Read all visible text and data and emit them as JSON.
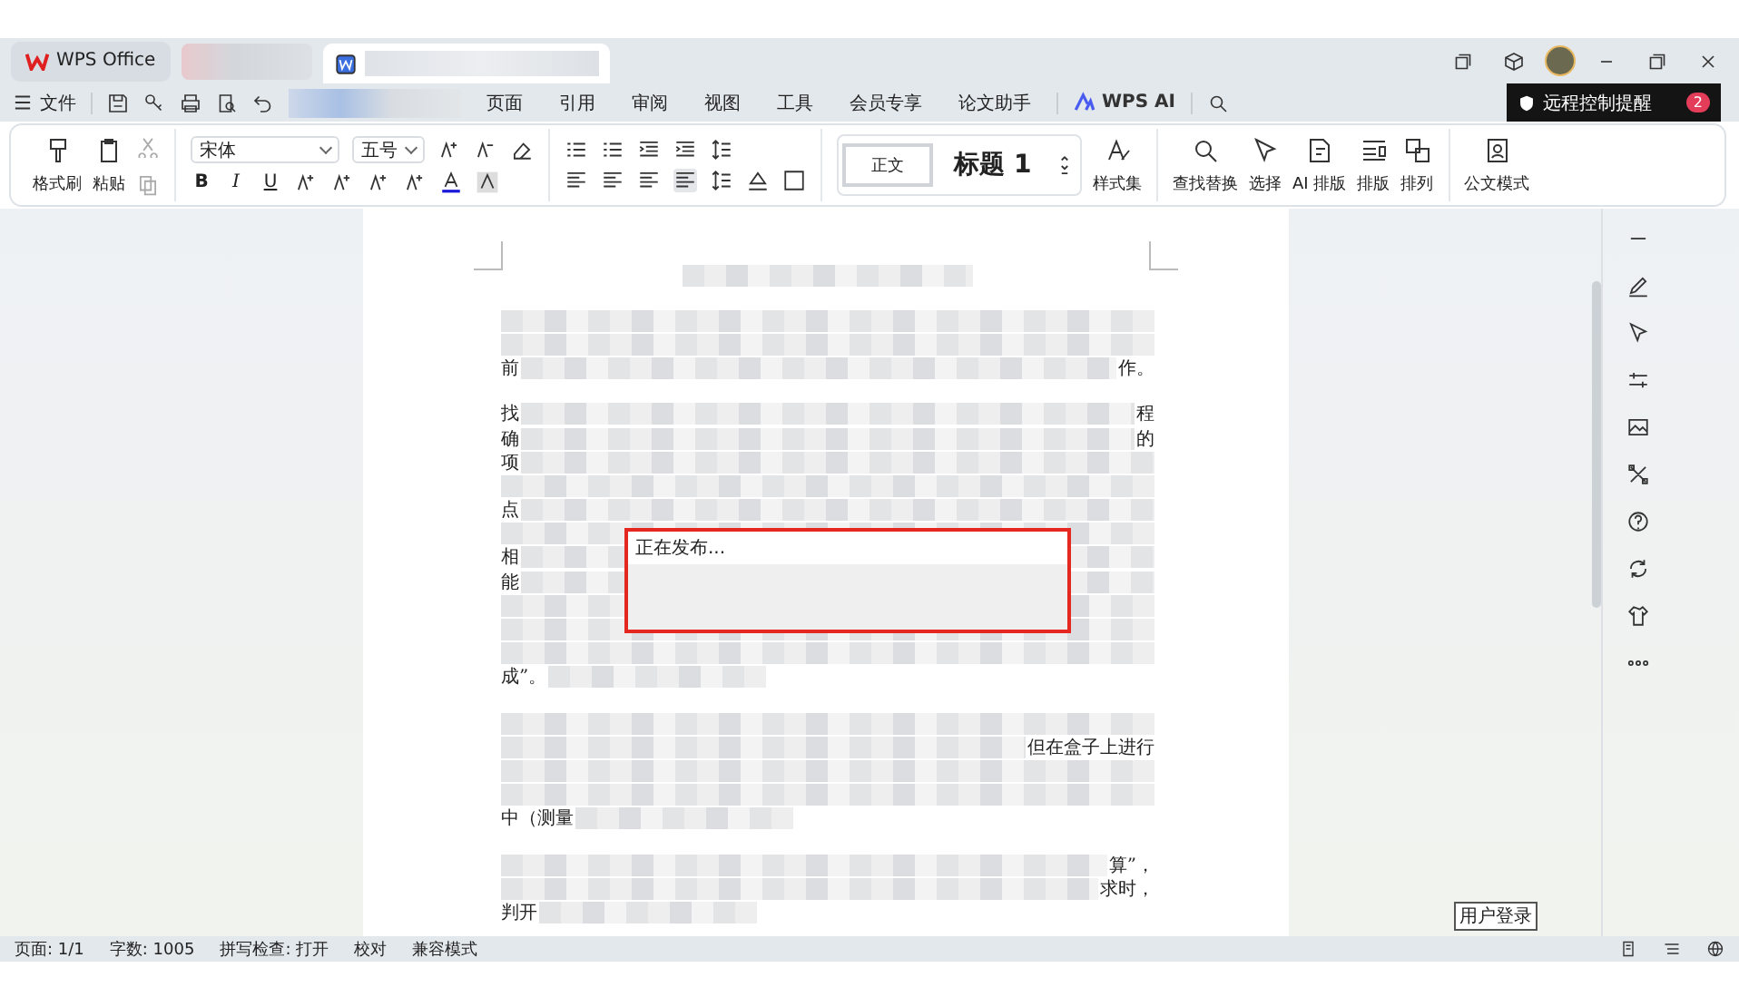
{
  "title_bar": {
    "home_tab": "WPS Office"
  },
  "menu": {
    "file": "文件",
    "tabs": [
      "页面",
      "引用",
      "审阅",
      "视图",
      "工具",
      "会员专享",
      "论文助手"
    ],
    "ai": "WPS AI"
  },
  "notification": {
    "text": "远程控制提醒",
    "badge": "2"
  },
  "ribbon": {
    "format_painter": "格式刷",
    "paste": "粘贴",
    "font": "宋体",
    "font_size": "五号",
    "format_letters": [
      "B",
      "I",
      "U"
    ],
    "styles": [
      {
        "label": "正文",
        "selected": true
      },
      {
        "label": "标题 1",
        "selected": false
      }
    ],
    "style_set": "样式集",
    "tools": [
      "查找替换",
      "选择",
      "AI 排版",
      "排版",
      "排列"
    ],
    "doc_mode": "公文模式"
  },
  "document": {
    "paragraphs": [
      {
        "lines": [
          {
            "kind": "title"
          }
        ]
      },
      {
        "lines": [
          {
            "kind": "redacted"
          },
          {
            "kind": "redacted"
          },
          {
            "kind": "text",
            "left": "前",
            "right": "作。"
          }
        ]
      },
      {
        "lines": [
          {
            "kind": "text",
            "left": "找",
            "right": "程"
          },
          {
            "kind": "text",
            "left": "确",
            "right": "的"
          },
          {
            "kind": "text",
            "left": "项"
          },
          {
            "kind": "redacted"
          },
          {
            "kind": "text",
            "left": "点"
          },
          {
            "kind": "redacted"
          },
          {
            "kind": "text",
            "left": "相"
          },
          {
            "kind": "text",
            "left": "能"
          },
          {
            "kind": "redacted"
          },
          {
            "kind": "redacted"
          },
          {
            "kind": "redacted"
          },
          {
            "kind": "end",
            "left": "成”。"
          }
        ]
      },
      {
        "lines": [
          {
            "kind": "redacted"
          },
          {
            "kind": "text",
            "right": "但在盒子上进行"
          },
          {
            "kind": "redacted"
          },
          {
            "kind": "redacted"
          },
          {
            "kind": "end",
            "left": "中（测量"
          }
        ]
      },
      {
        "lines": [
          {
            "kind": "text",
            "right": "算”，"
          },
          {
            "kind": "text",
            "right": "求时，"
          },
          {
            "kind": "end",
            "left": "判开"
          }
        ]
      }
    ]
  },
  "dialog": {
    "message": "正在发布..."
  },
  "tooltip": "用户登录",
  "status_bar": {
    "items": [
      "页面: 1/1",
      "字数: 1005",
      "拼写检查: 打开",
      "校对",
      "兼容模式"
    ]
  }
}
